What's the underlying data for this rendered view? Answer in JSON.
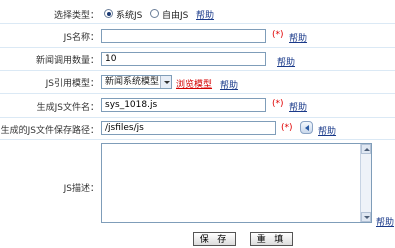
{
  "form": {
    "select_type": {
      "label": "选择类型：",
      "options": [
        {
          "label": "系统JS",
          "checked": true
        },
        {
          "label": "自由JS",
          "checked": false
        }
      ],
      "help": "帮助"
    },
    "js_name": {
      "label": "JS名称：",
      "value": "",
      "required": "(*)",
      "help": "帮助"
    },
    "news_count": {
      "label": "新闻调用数量：",
      "value": "10",
      "help": "帮助"
    },
    "js_template": {
      "label": "JS引用模型：",
      "selected": "新闻系统模型",
      "preview": "浏览模型",
      "help": "帮助"
    },
    "js_filename": {
      "label": "生成JS文件名：",
      "value": "sys_1018.js",
      "required": "(*)",
      "help": "帮助"
    },
    "save_path": {
      "label": "生成的JS文件保存路径：",
      "value": "/jsfiles/js",
      "required": "(*)",
      "help": "帮助"
    },
    "description": {
      "label": "JS描述：",
      "value": "",
      "help": "帮助"
    },
    "buttons": {
      "save": "保 存",
      "reset": "重 填"
    }
  }
}
